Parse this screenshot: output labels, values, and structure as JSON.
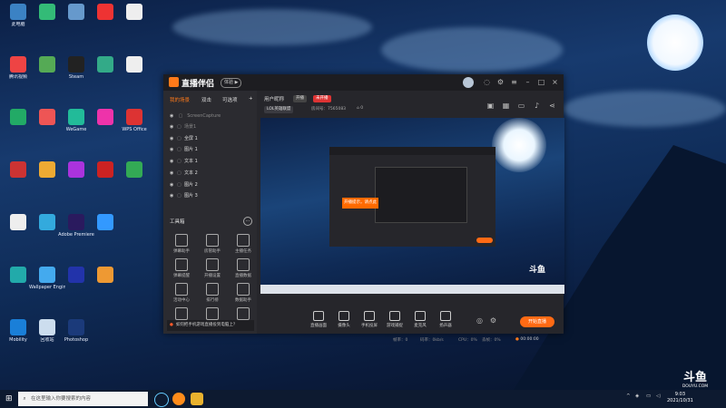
{
  "desktop": {
    "icons": [
      {
        "label": "此电脑",
        "color": "#3b82c4"
      },
      {
        "label": "腾讯视频",
        "color": "#e44"
      },
      {
        "label": "",
        "color": "#2a6"
      },
      {
        "label": "",
        "color": "#c33"
      },
      {
        "label": "",
        "color": "#eee"
      },
      {
        "label": "",
        "color": "#2aa"
      },
      {
        "label": "Mobility",
        "color": "#1a7fd8"
      },
      {
        "label": "",
        "color": "#3b7"
      },
      {
        "label": "",
        "color": "#5a5"
      },
      {
        "label": "",
        "color": "#e55"
      },
      {
        "label": "",
        "color": "#ea3"
      },
      {
        "label": "",
        "color": "#3ad"
      },
      {
        "label": "Wallpaper Engine",
        "color": "#4ae"
      },
      {
        "label": "回收站",
        "color": "#cde"
      },
      {
        "label": "",
        "color": "#69c"
      },
      {
        "label": "Steam",
        "color": "#222"
      },
      {
        "label": "WeGame",
        "color": "#2b9"
      },
      {
        "label": "",
        "color": "#a3d"
      },
      {
        "label": "Adobe Premiere",
        "color": "#2a1a5e"
      },
      {
        "label": "",
        "color": "#23a"
      },
      {
        "label": "Photoshop",
        "color": "#1b3a7a"
      },
      {
        "label": "",
        "color": "#e33"
      },
      {
        "label": "",
        "color": "#3a8"
      },
      {
        "label": "",
        "color": "#e3a"
      },
      {
        "label": "",
        "color": "#c22"
      },
      {
        "label": "",
        "color": "#39f"
      },
      {
        "label": "",
        "color": "#e93"
      },
      {
        "label": "",
        "color": "#eee"
      },
      {
        "label": "",
        "color": "#eee"
      },
      {
        "label": "WPS Office",
        "color": "#d33"
      },
      {
        "label": "",
        "color": "#3a5"
      }
    ],
    "watermark": {
      "logo": "斗鱼",
      "site": "DOUYU.COM"
    }
  },
  "app": {
    "name": "直播伴侣",
    "badge": "体验 ▶",
    "tabs": [
      "我的场景",
      "双击",
      "可选项"
    ],
    "room_label": "用户昵称",
    "room_tag": "开播",
    "room_status": "未开播",
    "category": "LOL英雄联盟",
    "room_id": "房间号：7565083",
    "viewers": "0",
    "sources_header": "ScreenCapture",
    "sources": [
      {
        "label": "场景1"
      },
      {
        "label": "全屏 1"
      },
      {
        "label": "图片 1"
      },
      {
        "label": "文本 1"
      },
      {
        "label": "文本 2"
      },
      {
        "label": "图片 2"
      },
      {
        "label": "图片 3"
      }
    ],
    "tools_title": "工具箱",
    "tools": [
      [
        "弹幕助手",
        "房管助手",
        "主播任务"
      ],
      [
        "弹幕提醒",
        "开播设置",
        "直播数据"
      ],
      [
        "活动中心",
        "排行榜",
        "数据助手"
      ],
      [
        "",
        "",
        ""
      ]
    ],
    "bottom_notice": "如何把手机游戏直播投到电脑上？",
    "controls": [
      "直播画面",
      "摄像头",
      "手机投屏",
      "游戏捕捉",
      "麦克风",
      "扬声器"
    ],
    "start_button": "开始直播",
    "status": {
      "fps": "帧率：0",
      "bitrate": "码率：0kb/s",
      "cpu": "CPU：0%",
      "drop": "丢帧：0%",
      "time": "00:00:00"
    },
    "inner_tip": "开播提示，请点此"
  },
  "taskbar": {
    "search_placeholder": "在这里输入你要搜索的内容",
    "time": "9:03",
    "date": "2021/10/31"
  }
}
